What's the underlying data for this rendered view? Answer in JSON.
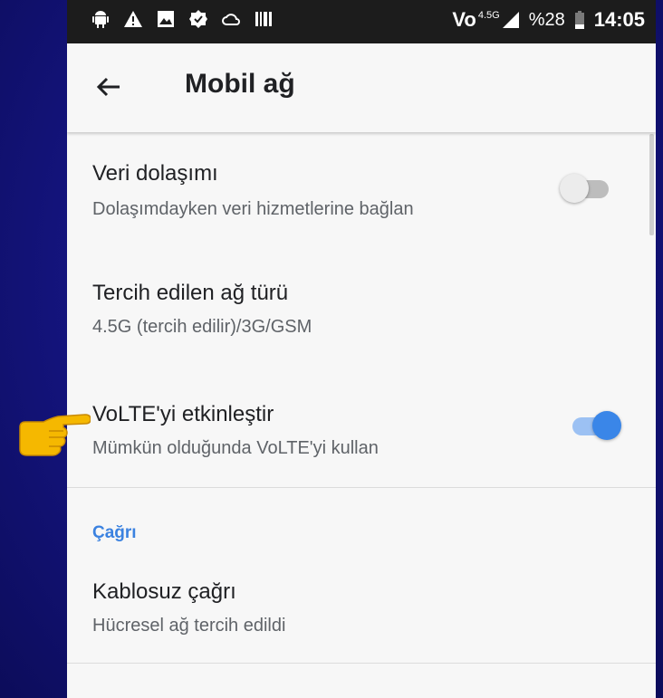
{
  "status_bar": {
    "left_icons": [
      "android-icon",
      "warning-icon",
      "image-icon",
      "settings-badge-icon",
      "cloud-sync-icon",
      "barcode-icon"
    ],
    "volte_label": "Vo",
    "network_label": "4.5G",
    "battery_text": "%28",
    "time": "14:05"
  },
  "toolbar": {
    "title": "Mobil ağ"
  },
  "settings": [
    {
      "title": "Veri dolaşımı",
      "subtitle": "Dolaşımdayken veri hizmetlerine bağlan",
      "toggle": false
    },
    {
      "title": "Tercih edilen ağ türü",
      "subtitle": "4.5G (tercih edilir)/3G/GSM"
    },
    {
      "title": "VoLTE'yi etkinleştir",
      "subtitle": "Mümkün olduğunda VoLTE'yi kullan",
      "toggle": true
    }
  ],
  "section_header": "Çağrı",
  "call_settings": [
    {
      "title": "Kablosuz çağrı",
      "subtitle": "Hücresel ağ tercih edildi"
    }
  ],
  "colors": {
    "accent": "#3a86e8",
    "background_blue": "#14147e",
    "pointer_hand": "#f5b800"
  }
}
